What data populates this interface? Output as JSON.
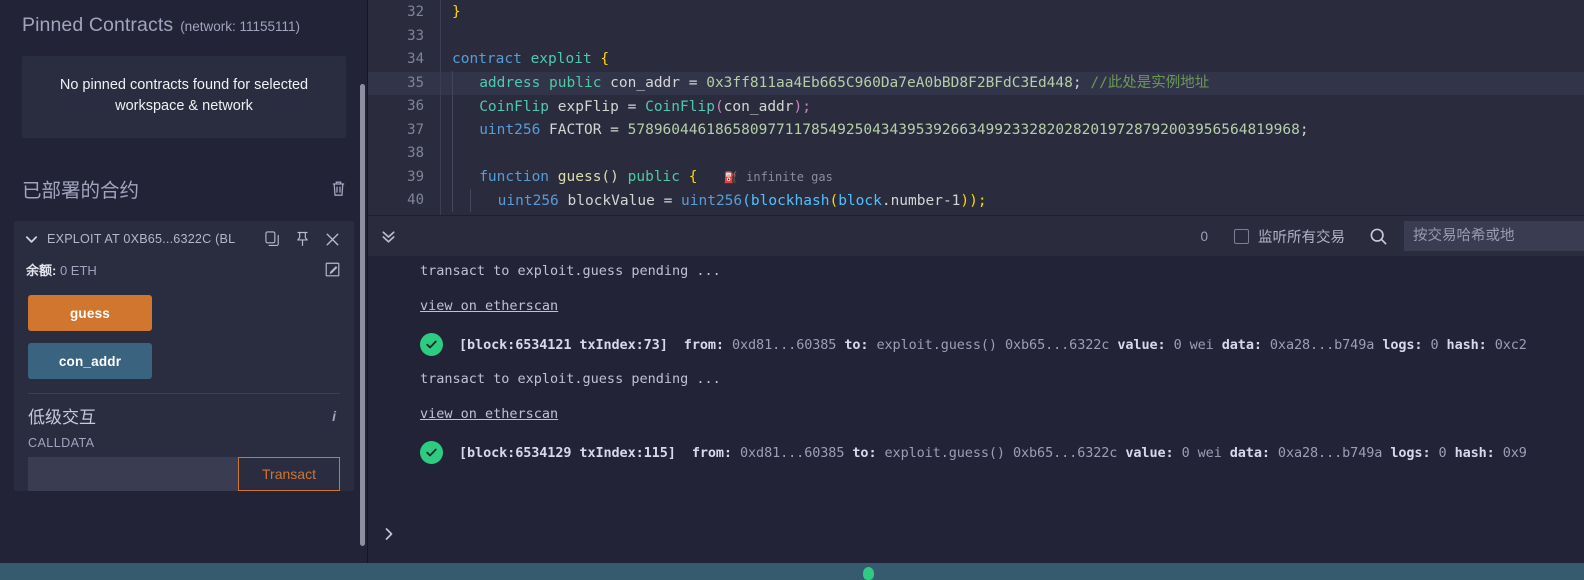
{
  "sidebar": {
    "pinned": {
      "title": "Pinned Contracts",
      "network": "(network: 11155111)",
      "empty_message": "No pinned contracts found for selected workspace & network"
    },
    "deployed": {
      "title": "已部署的合约",
      "clear_icon": "trash-icon"
    },
    "contract": {
      "label": "EXPLOIT AT 0XB65...6322C (BL",
      "balance_label": "余额:",
      "balance_value": "0 ETH",
      "copy_icon": "copy-icon",
      "pin_icon": "pin-icon",
      "close_icon": "close-icon",
      "edit_icon": "edit-icon",
      "functions": [
        {
          "label": "guess",
          "kind": "warn"
        },
        {
          "label": "con_addr",
          "kind": "info"
        }
      ]
    },
    "lowlevel": {
      "title": "低级交互",
      "info_icon": "info-icon",
      "calldata_label": "CALLDATA",
      "calldata_value": "",
      "calldata_placeholder": "",
      "transact_label": "Transact"
    }
  },
  "editor": {
    "lines": [
      {
        "no": "32",
        "indent": 0,
        "highlight": false
      },
      {
        "no": "33",
        "indent": 0,
        "highlight": false
      },
      {
        "no": "34",
        "indent": 0,
        "highlight": false
      },
      {
        "no": "35",
        "indent": 1,
        "highlight": true
      },
      {
        "no": "36",
        "indent": 1,
        "highlight": false
      },
      {
        "no": "37",
        "indent": 1,
        "highlight": false
      },
      {
        "no": "38",
        "indent": 1,
        "highlight": false
      },
      {
        "no": "39",
        "indent": 1,
        "highlight": false
      },
      {
        "no": "40",
        "indent": 2,
        "highlight": false
      }
    ],
    "code": {
      "l32_brace": "}",
      "l34_contract": "contract",
      "l34_name": "exploit",
      "l34_brace": "{",
      "l35_type": "address",
      "l35_vis": "public",
      "l35_var": "con_addr",
      "l35_eq": "=",
      "l35_addr": "0x3ff811aa4Eb665C960Da7eA0bBD8F2BFdC3Ed448",
      "l35_semi": ";",
      "l35_comment": "//此处是实例地址",
      "l36_type": "CoinFlip",
      "l36_var": "expFlip",
      "l36_eq": "=",
      "l36_call": "CoinFlip",
      "l36_arg": "con_addr",
      "l36_tail": ");",
      "l37_type": "uint256",
      "l37_var": "FACTOR",
      "l37_eq": "=",
      "l37_num": "57896044618658097711785492504343953926634992332820282019728792003956564819968",
      "l37_semi": ";",
      "l39_kw": "function",
      "l39_name": "guess()",
      "l39_vis": "public",
      "l39_brace": "{",
      "l39_gas": "infinite gas",
      "l40_type": "uint256",
      "l40_var": "blockValue",
      "l40_eq": "=",
      "l40_cast": "uint256",
      "l40_fn": "blockhash",
      "l40_obj": "block",
      "l40_prop": ".number-1",
      "l40_tail": "));"
    }
  },
  "terminal": {
    "toolbar": {
      "collapse_icon": "chevrons-down-icon",
      "count": "0",
      "listen_label": "监听所有交易",
      "listen_checked": false,
      "search_icon": "search-icon",
      "search_value": "",
      "search_placeholder": "按交易哈希或地"
    },
    "expand_icon": "chevron-right-icon",
    "entries": [
      {
        "type": "pending",
        "text": "transact to exploit.guess pending ..."
      },
      {
        "type": "link",
        "text": "view on etherscan"
      },
      {
        "type": "tx",
        "status": "ok",
        "block": "[block:6534121 txIndex:73]",
        "from_label": "from:",
        "from": "0xd81...60385",
        "to_label": "to:",
        "to": "exploit.guess()",
        "to_addr": "0xb65...6322c",
        "value_label": "value:",
        "value": "0 wei",
        "data_label": "data:",
        "data": "0xa28...b749a",
        "logs_label": "logs:",
        "logs": "0",
        "hash_label": "hash:",
        "hash": "0xc2"
      },
      {
        "type": "pending",
        "text": "transact to exploit.guess pending ..."
      },
      {
        "type": "link",
        "text": "view on etherscan"
      },
      {
        "type": "tx",
        "status": "ok",
        "block": "[block:6534129 txIndex:115]",
        "from_label": "from:",
        "from": "0xd81...60385",
        "to_label": "to:",
        "to": "exploit.guess()",
        "to_addr": "0xb65...6322c",
        "value_label": "value:",
        "value": "0 wei",
        "data_label": "data:",
        "data": "0xa28...b749a",
        "logs_label": "logs:",
        "logs": "0",
        "hash_label": "hash:",
        "hash": "0x9"
      }
    ]
  },
  "statusbar": {
    "text": ""
  },
  "colors": {
    "bg": "#222336",
    "panel": "#2a2c3e",
    "warn": "#d0762f",
    "info": "#3a6380",
    "success": "#2ecc82",
    "statusbar": "#365a6e"
  }
}
